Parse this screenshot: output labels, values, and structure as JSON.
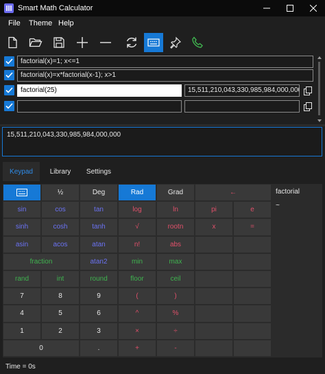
{
  "window": {
    "title": "Smart Math Calculator",
    "controls": {
      "minimize": "—",
      "maximize": "☐",
      "close": "✕"
    }
  },
  "menu": [
    {
      "label": "File"
    },
    {
      "label": "Theme"
    },
    {
      "label": "Help"
    }
  ],
  "toolbar": [
    {
      "icon": "new-file-icon",
      "active": false
    },
    {
      "icon": "open-folder-icon",
      "active": false
    },
    {
      "icon": "save-icon",
      "active": false
    },
    {
      "icon": "plus-icon",
      "active": false
    },
    {
      "icon": "minus-icon",
      "active": false
    },
    {
      "icon": "refresh-icon",
      "active": false
    },
    {
      "icon": "keyboard-icon",
      "active": true
    },
    {
      "icon": "pin-icon",
      "active": false
    },
    {
      "icon": "phone-icon",
      "active": false
    }
  ],
  "expressions": [
    {
      "checked": true,
      "value": "factorial(x)=1; x<=1"
    },
    {
      "checked": true,
      "value": "factorial(x)=x*factorial(x-1); x>1"
    },
    {
      "checked": true,
      "value": "factorial(25)",
      "result": "15,511,210,043,330,985,984,000,000"
    },
    {
      "checked": true,
      "value": "",
      "result": ""
    }
  ],
  "result": {
    "text": "15,511,210,043,330,985,984,000,000"
  },
  "tabs": [
    {
      "label": "Keypad",
      "active": true
    },
    {
      "label": "Library",
      "active": false
    },
    {
      "label": "Settings",
      "active": false
    }
  ],
  "keypad": {
    "rows": [
      [
        {
          "label": "",
          "icon": "keyboard-icon",
          "color": "white",
          "active": true
        },
        {
          "label": "½",
          "color": "white"
        },
        {
          "label": "Deg",
          "color": "white"
        },
        {
          "label": "Rad",
          "color": "white",
          "active": true
        },
        {
          "label": "Grad",
          "color": "white"
        },
        {
          "label": "←",
          "color": "red",
          "span": 2
        }
      ],
      [
        {
          "label": "sin",
          "color": "blue"
        },
        {
          "label": "cos",
          "color": "blue"
        },
        {
          "label": "tan",
          "color": "blue"
        },
        {
          "label": "log",
          "color": "red"
        },
        {
          "label": "ln",
          "color": "red"
        },
        {
          "label": "pi",
          "color": "red"
        },
        {
          "label": "e",
          "color": "red"
        }
      ],
      [
        {
          "label": "sinh",
          "color": "blue"
        },
        {
          "label": "cosh",
          "color": "blue"
        },
        {
          "label": "tanh",
          "color": "blue"
        },
        {
          "label": "√",
          "color": "red"
        },
        {
          "label": "rootn",
          "color": "red"
        },
        {
          "label": "x",
          "color": "red"
        },
        {
          "label": "=",
          "color": "red"
        }
      ],
      [
        {
          "label": "asin",
          "color": "blue"
        },
        {
          "label": "acos",
          "color": "blue"
        },
        {
          "label": "atan",
          "color": "blue"
        },
        {
          "label": "n!",
          "color": "red"
        },
        {
          "label": "abs",
          "color": "red"
        },
        {
          "label": "",
          "color": "red"
        },
        {
          "label": "",
          "color": "red"
        }
      ],
      [
        {
          "label": "fraction",
          "color": "green",
          "span": 2
        },
        {
          "label": "atan2",
          "color": "blue"
        },
        {
          "label": "min",
          "color": "green"
        },
        {
          "label": "max",
          "color": "green"
        },
        {
          "label": "",
          "color": "white"
        },
        {
          "label": "",
          "color": "white"
        }
      ],
      [
        {
          "label": "rand",
          "color": "green"
        },
        {
          "label": "int",
          "color": "green"
        },
        {
          "label": "round",
          "color": "green"
        },
        {
          "label": "floor",
          "color": "green"
        },
        {
          "label": "ceil",
          "color": "green"
        },
        {
          "label": "",
          "color": "white"
        },
        {
          "label": "",
          "color": "white"
        }
      ],
      [
        {
          "label": "7",
          "color": "white"
        },
        {
          "label": "8",
          "color": "white"
        },
        {
          "label": "9",
          "color": "white"
        },
        {
          "label": "(",
          "color": "red"
        },
        {
          "label": ")",
          "color": "red"
        },
        {
          "label": "",
          "color": "white"
        },
        {
          "label": "",
          "color": "white"
        }
      ],
      [
        {
          "label": "4",
          "color": "white"
        },
        {
          "label": "5",
          "color": "white"
        },
        {
          "label": "6",
          "color": "white"
        },
        {
          "label": "^",
          "color": "red"
        },
        {
          "label": "%",
          "color": "red"
        },
        {
          "label": "",
          "color": "white"
        },
        {
          "label": "",
          "color": "white"
        }
      ],
      [
        {
          "label": "1",
          "color": "white"
        },
        {
          "label": "2",
          "color": "white"
        },
        {
          "label": "3",
          "color": "white"
        },
        {
          "label": "×",
          "color": "red"
        },
        {
          "label": "÷",
          "color": "red"
        },
        {
          "label": "",
          "color": "white"
        },
        {
          "label": "",
          "color": "white"
        }
      ],
      [
        {
          "label": "0",
          "color": "white",
          "span": 2
        },
        {
          "label": ".",
          "color": "white"
        },
        {
          "label": "+",
          "color": "red"
        },
        {
          "label": "-",
          "color": "red"
        },
        {
          "label": "",
          "color": "white"
        },
        {
          "label": "",
          "color": "white"
        }
      ]
    ]
  },
  "library": {
    "items": [
      {
        "label": "factorial"
      },
      {
        "label": "~"
      }
    ]
  },
  "status": {
    "text": "Time = 0s"
  }
}
